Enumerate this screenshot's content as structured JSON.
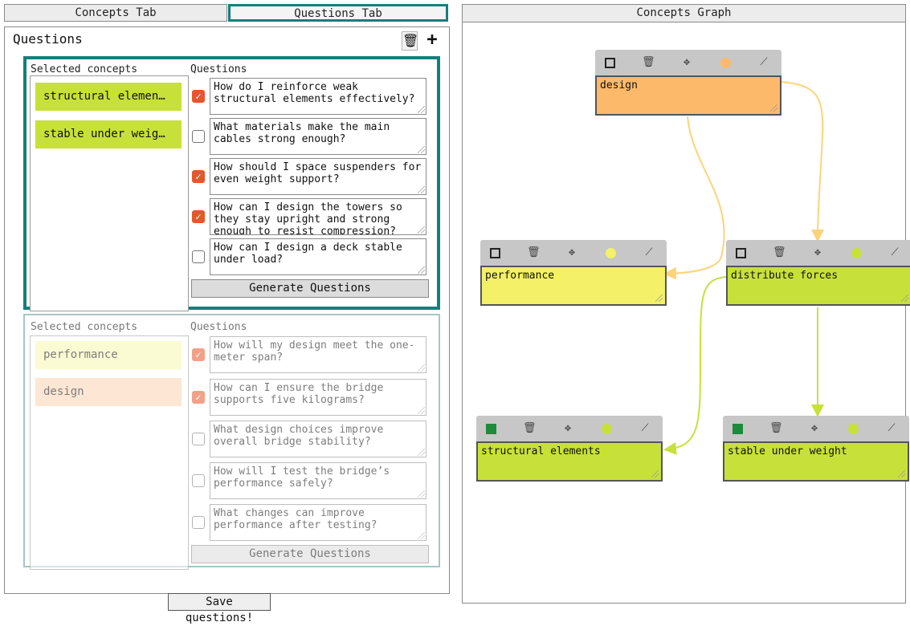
{
  "tabs": {
    "concepts": "Concepts Tab",
    "questions": "Questions Tab"
  },
  "questions_panel": {
    "title": "Questions",
    "delete_icon": "🗑",
    "add_icon": "+",
    "save_label": "Save questions!",
    "sets": [
      {
        "selected_label": "Selected concepts",
        "questions_label": "Questions",
        "concepts": [
          {
            "label": "structural elemen…",
            "color": "#c8e03a"
          },
          {
            "label": "stable under weig…",
            "color": "#c8e03a"
          }
        ],
        "questions": [
          {
            "text": "How do I reinforce weak structural elements effectively?",
            "checked": true
          },
          {
            "text": "What materials make the main cables strong enough?",
            "checked": false
          },
          {
            "text": "How should I space suspenders for even weight support?",
            "checked": true
          },
          {
            "text": "How can I design the towers so they stay upright and strong enough to resist compression?",
            "checked": true
          },
          {
            "text": "How can I design a deck stable under load?",
            "checked": false
          }
        ],
        "generate_label": "Generate Questions"
      },
      {
        "selected_label": "Selected concepts",
        "questions_label": "Questions",
        "concepts": [
          {
            "label": "performance",
            "color": "#f9f9b0"
          },
          {
            "label": "design",
            "color": "#fcd3b0"
          }
        ],
        "questions": [
          {
            "text": "How will my design meet the one-meter span?",
            "checked": true
          },
          {
            "text": "How can I ensure the bridge supports five kilograms?",
            "checked": true
          },
          {
            "text": "What design choices improve overall bridge stability?",
            "checked": false
          },
          {
            "text": "How will I test the bridge’s performance safely?",
            "checked": false
          },
          {
            "text": "What changes can improve performance after testing?",
            "checked": false
          }
        ],
        "generate_label": "Generate Questions"
      }
    ]
  },
  "graph": {
    "header": "Concepts Graph",
    "nodes": {
      "design": {
        "label": "design",
        "color": "#fdb96a",
        "dot_color": "#fdb96a",
        "checked": false
      },
      "performance": {
        "label": "performance",
        "color": "#f4f068",
        "dot_color": "#f4f068",
        "checked": false
      },
      "distribute": {
        "label": "distribute forces",
        "color": "#c8e03a",
        "dot_color": "#c8e03a",
        "checked": false
      },
      "structural": {
        "label": "structural elements",
        "color": "#c8e03a",
        "dot_color": "#c8e03a",
        "checked": true
      },
      "stable": {
        "label": "stable under weight",
        "color": "#c8e03a",
        "dot_color": "#c8e03a",
        "checked": true
      }
    },
    "toolbar_icons": [
      "select-box-icon",
      "trash-icon",
      "move-icon",
      "color-dot-icon",
      "connect-icon"
    ],
    "edge_colors": {
      "from_design": "#fdd37a",
      "from_distribute": "#c8e03a"
    }
  }
}
